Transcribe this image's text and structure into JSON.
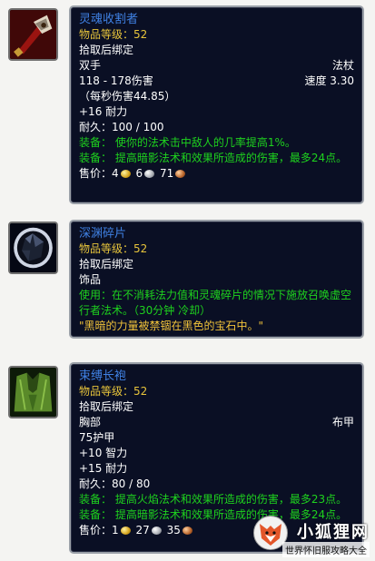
{
  "items": [
    {
      "name": "灵魂收割者",
      "item_level": "物品等级：52",
      "bind": "拾取后绑定",
      "slot": "双手",
      "type": "法杖",
      "damage": "118 - 178伤害",
      "speed": "速度 3.30",
      "dps": "（每秒伤害44.85）",
      "stat1": "+16 耐力",
      "durability": "耐久：100 / 100",
      "equip1": "装备：  使你的法术击中敌人的几率提高1%。",
      "equip2": "装备：  提高暗影法术和效果所造成的伤害，最多24点。",
      "sell_label": "售价：",
      "gold": "4",
      "silver": "6",
      "copper": "71",
      "icon": "sword-axe-icon"
    },
    {
      "name": "深渊碎片",
      "item_level": "物品等级：52",
      "bind": "拾取后绑定",
      "slot": "饰品",
      "use": "使用：在不消耗法力值和灵魂碎片的情况下施放召唤虚空行者法术。（30分钟 冷却）",
      "flavor": "\"黑暗的力量被禁锢在黑色的宝石中。\"",
      "icon": "gem-icon"
    },
    {
      "name": "束缚长袍",
      "item_level": "物品等级：52",
      "bind": "拾取后绑定",
      "slot": "胸部",
      "type": "布甲",
      "armor": "75护甲",
      "stat1": "+10 智力",
      "stat2": "+15 耐力",
      "durability": "耐久：80 / 80",
      "equip1": "装备：  提高火焰法术和效果所造成的伤害，最多23点。",
      "equip2": "装备：  提高暗影法术和效果所造成的伤害，最多24点。",
      "sell_label": "售价：",
      "gold": "1",
      "silver": "27",
      "copper": "35",
      "icon": "robe-icon"
    }
  ],
  "watermark": {
    "brand": "小狐狸网",
    "caption": "世界怀旧服攻略大全"
  }
}
